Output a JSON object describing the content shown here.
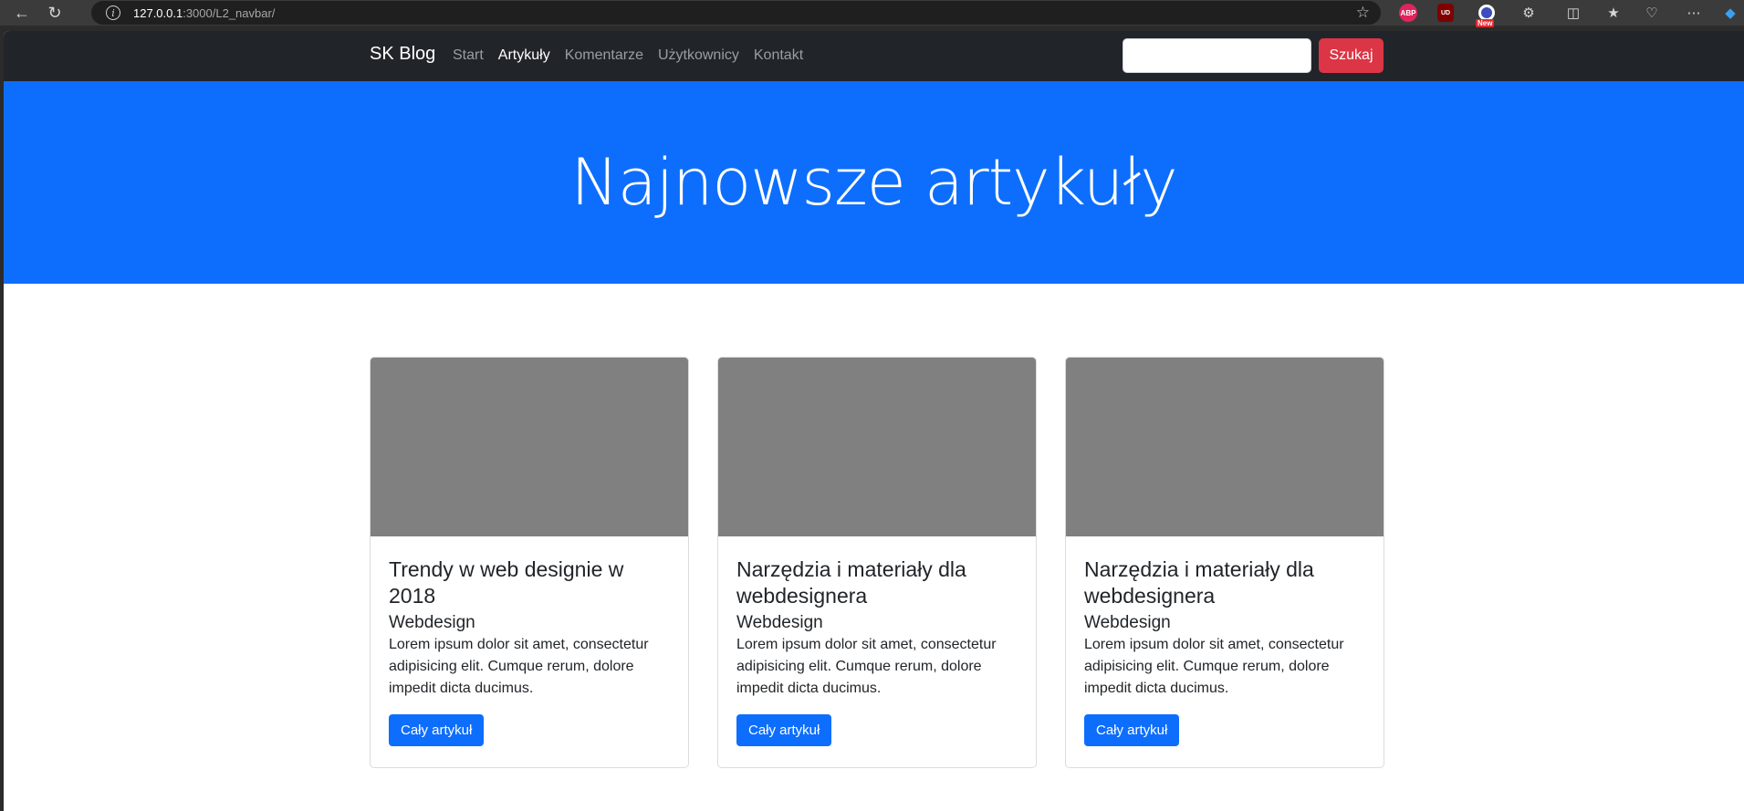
{
  "browser": {
    "url_host": "127.0.0.1",
    "url_path": ":3000/L2_navbar/",
    "extensions": {
      "abp": "ABP",
      "ublock": "UD",
      "new_badge": "New"
    }
  },
  "navbar": {
    "brand": "SK Blog",
    "links": [
      {
        "label": "Start",
        "active": false
      },
      {
        "label": "Artykuły",
        "active": true
      },
      {
        "label": "Komentarze",
        "active": false
      },
      {
        "label": "Użytkownicy",
        "active": false
      },
      {
        "label": "Kontakt",
        "active": false
      }
    ],
    "search_button": "Szukaj",
    "search_placeholder": ""
  },
  "hero": {
    "title": "Najnowsze artykuły"
  },
  "cards": [
    {
      "title": "Trendy w web designie w 2018",
      "subtitle": "Webdesign",
      "text": "Lorem ipsum dolor sit amet, consectetur adipisicing elit. Cumque rerum, dolore impedit dicta ducimus.",
      "button": "Cały artykuł"
    },
    {
      "title": "Narzędzia i materiały dla webdesignera",
      "subtitle": "Webdesign",
      "text": "Lorem ipsum dolor sit amet, consectetur adipisicing elit. Cumque rerum, dolore impedit dicta ducimus.",
      "button": "Cały artykuł"
    },
    {
      "title": "Narzędzia i materiały dla webdesignera",
      "subtitle": "Webdesign",
      "text": "Lorem ipsum dolor sit amet, consectetur adipisicing elit. Cumque rerum, dolore impedit dicta ducimus.",
      "button": "Cały artykuł"
    }
  ],
  "colors": {
    "navbar_bg": "#212529",
    "hero_bg": "#0d6efd",
    "search_button": "#dc3545",
    "card_button": "#0d6efd",
    "card_image": "#808080"
  }
}
